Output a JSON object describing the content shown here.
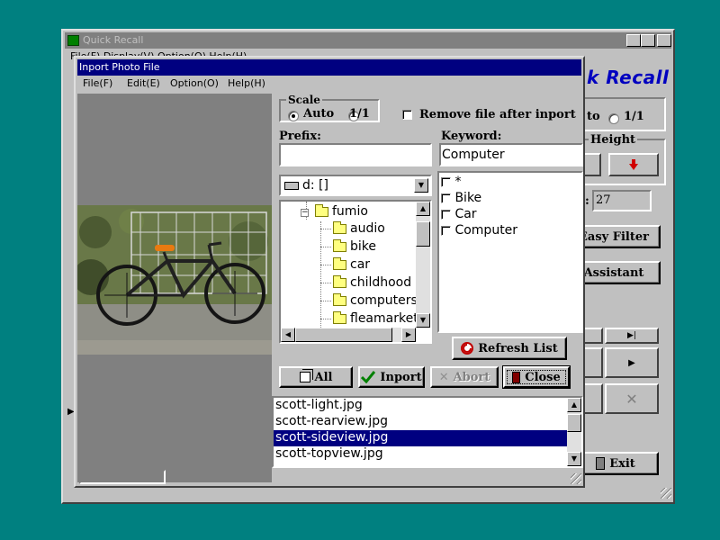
{
  "background_window": {
    "title": "Quick Recall",
    "menu_partial": "File(F)  Display(V)  Option(O)  Help(H)",
    "logo_text": "k Recall",
    "scale_partial_auto": "to",
    "scale_partial_11": "1/1",
    "height_label": "Height",
    "count_prefix": ":",
    "count_value": "27",
    "easy_filter_label": "Easy Filter",
    "assistant_label": "Assistant",
    "exit_label": "Exit",
    "controls": {
      "minimize": "_",
      "maximize": "□",
      "close": "×"
    }
  },
  "dialog": {
    "title": "Inport Photo File",
    "menu": [
      "File(F)",
      "Edit(E)",
      "Option(O)",
      "Help(H)"
    ],
    "scale": {
      "label": "Scale",
      "auto": "Auto",
      "one_to_one": "1/1",
      "selected": "Auto"
    },
    "remove_after_inport": {
      "label": "Remove file after inport",
      "checked": false
    },
    "prefix": {
      "label": "Prefix:",
      "value": ""
    },
    "keyword": {
      "label": "Keyword:",
      "value": "Computer"
    },
    "drive": {
      "value": "d: []"
    },
    "folders": [
      {
        "name": "fumio",
        "level": 0
      },
      {
        "name": "audio",
        "level": 1
      },
      {
        "name": "bike",
        "level": 1
      },
      {
        "name": "car",
        "level": 1
      },
      {
        "name": "childhood",
        "level": 1
      },
      {
        "name": "computers",
        "level": 1
      },
      {
        "name": "fleamarket",
        "level": 1
      }
    ],
    "keywords": [
      {
        "label": "*",
        "checked": false
      },
      {
        "label": "Bike",
        "checked": false
      },
      {
        "label": "Car",
        "checked": false
      },
      {
        "label": "Computer",
        "checked": false
      }
    ],
    "buttons": {
      "refresh": "Refresh List",
      "all": "All",
      "inport": "Inport",
      "abort": "Abort",
      "close": "Close"
    },
    "files": [
      {
        "name": "scott-light.jpg",
        "selected": false
      },
      {
        "name": "scott-rearview.jpg",
        "selected": false
      },
      {
        "name": "scott-sideview.jpg",
        "selected": true
      },
      {
        "name": "scott-topview.jpg",
        "selected": false
      }
    ]
  },
  "colors": {
    "desktop": "#008080",
    "active_title": "#000080",
    "inactive_title": "#808080",
    "face": "#c0c0c0",
    "logo": "#0000c0",
    "selection": "#000080"
  }
}
